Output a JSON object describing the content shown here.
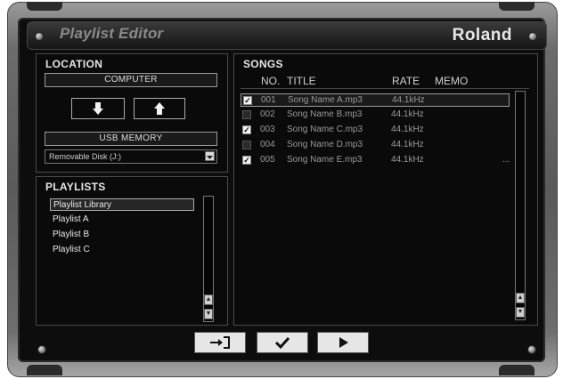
{
  "header": {
    "title": "Playlist Editor",
    "brand": "Roland"
  },
  "location": {
    "title": "LOCATION",
    "computer_label": "COMPUTER",
    "usb_label": "USB MEMORY",
    "disk_value": "Removable Disk (J:)",
    "down_icon": "arrow-down-icon",
    "up_icon": "arrow-up-icon"
  },
  "playlists": {
    "title": "PLAYLISTS",
    "items": [
      "Playlist Library",
      "Playlist A",
      "Playlist B",
      "Playlist C"
    ],
    "selected_index": 0
  },
  "songs": {
    "title": "SONGS",
    "columns": {
      "no": "NO.",
      "title": "TITLE",
      "rate": "RATE",
      "memo": "MEMO"
    },
    "rows": [
      {
        "checked": true,
        "no": "001",
        "title": "Song Name A.mp3",
        "rate": "44.1kHz",
        "memo": ""
      },
      {
        "checked": false,
        "no": "002",
        "title": "Song Name B.mp3",
        "rate": "44.1kHz",
        "memo": ""
      },
      {
        "checked": true,
        "no": "003",
        "title": "Song Name C.mp3",
        "rate": "44.1kHz",
        "memo": ""
      },
      {
        "checked": false,
        "no": "004",
        "title": "Song Name D.mp3",
        "rate": "44.1kHz",
        "memo": ""
      },
      {
        "checked": true,
        "no": "005",
        "title": "Song Name E.mp3",
        "rate": "44.1kHz",
        "memo": "..."
      }
    ],
    "selected_index": 0
  },
  "toolbar": {
    "import_icon": "import-icon",
    "apply_icon": "checkmark-icon",
    "play_icon": "play-icon"
  },
  "colors": {
    "background": "#0d0d0d",
    "frame": "#6c6c6c",
    "text": "#e6e6e6",
    "muted": "#9a9a9a"
  }
}
